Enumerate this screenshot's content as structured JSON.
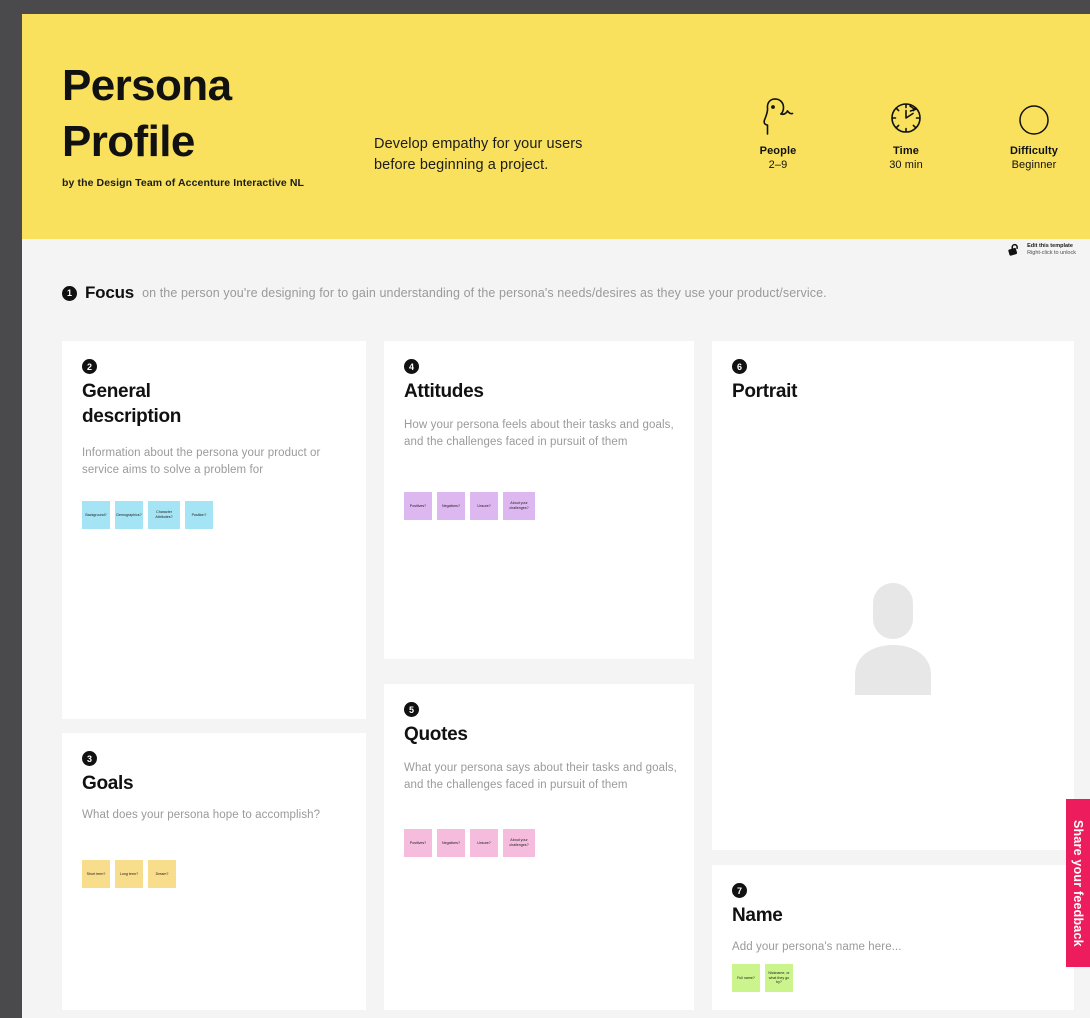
{
  "header": {
    "title_line1": "Persona",
    "title_line2": "Profile",
    "byline": "by the Design Team of Accenture Interactive NL",
    "subtitle_line1": "Develop empathy for your users",
    "subtitle_line2": "before beginning a project.",
    "meta": [
      {
        "icon": "people-icon",
        "label": "People",
        "value": "2–9"
      },
      {
        "icon": "clock-icon",
        "label": "Time",
        "value": "30 min"
      },
      {
        "icon": "circle-icon",
        "label": "Difficulty",
        "value": "Beginner"
      }
    ],
    "background_color": "#f9e15e"
  },
  "lock_badge": {
    "icon": "lock-icon",
    "title": "Edit this template",
    "hint": "Right-click to unlock"
  },
  "focus": {
    "step": "1",
    "title": "Focus",
    "text": "on the person you're designing for to gain understanding of the persona's needs/desires as they use your product/service."
  },
  "cards": {
    "general": {
      "step": "2",
      "title_line1": "General",
      "title_line2": "description",
      "description": "Information about the persona your product or service aims to solve a problem for",
      "note_color": "#a5e4f5",
      "notes": [
        "Background?",
        "Demographics?",
        "Character Attributes?",
        "Position?"
      ]
    },
    "goals": {
      "step": "3",
      "title": "Goals",
      "description": "What does your persona hope to accomplish?",
      "note_color": "#f8dd8c",
      "notes": [
        "Short term?",
        "Long term?",
        "Dream?"
      ]
    },
    "attitudes": {
      "step": "4",
      "title": "Attitudes",
      "description": "How your persona feels about their tasks and goals, and the challenges faced in pursuit of them",
      "note_color": "#ddb8f0",
      "notes": [
        "Positives?",
        "Negatives?",
        "Unsure?",
        "About your challenges?"
      ]
    },
    "quotes": {
      "step": "5",
      "title": "Quotes",
      "description": "What your persona says about their tasks and goals, and the challenges faced in pursuit of them",
      "note_color": "#f5bcdd",
      "notes": [
        "Positives?",
        "Negatives?",
        "Unsure?",
        "About your challenges?"
      ]
    },
    "portrait": {
      "step": "6",
      "title": "Portrait",
      "placeholder_icon": "person-silhouette-icon"
    },
    "name": {
      "step": "7",
      "title": "Name",
      "description": "Add your persona's name here...",
      "note_color": "#cbf58c",
      "notes": [
        "Full name?",
        "Nickname, or what they go by?"
      ]
    }
  },
  "feedback_tab": {
    "label": "Share your feedback",
    "color": "#ed1c5c"
  }
}
